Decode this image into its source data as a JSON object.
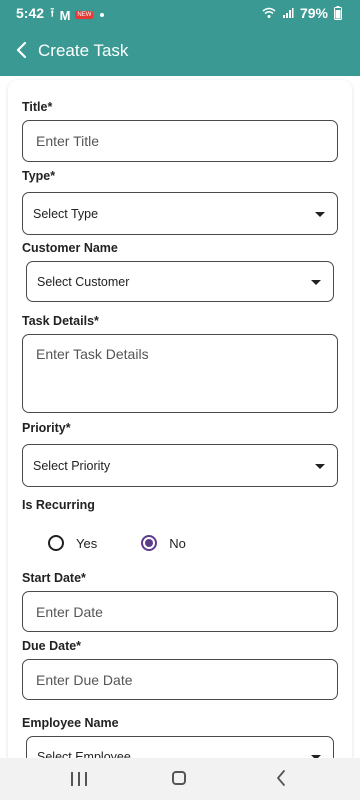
{
  "status": {
    "time": "5:42",
    "battery": "79%",
    "badge": "NEW"
  },
  "appbar": {
    "title": "Create Task"
  },
  "form": {
    "title_label": "Title*",
    "title_placeholder": "Enter Title",
    "type_label": "Type*",
    "type_value": "Select Type",
    "customer_label": "Customer Name",
    "customer_value": "Select Customer",
    "details_label": "Task Details*",
    "details_placeholder": "Enter Task Details",
    "priority_label": "Priority*",
    "priority_value": "Select Priority",
    "recurring_label": "Is Recurring",
    "recurring_yes": "Yes",
    "recurring_no": "No",
    "recurring_selected": "No",
    "start_label": "Start Date*",
    "start_placeholder": "Enter Date",
    "due_label": "Due Date*",
    "due_placeholder": "Enter Due Date",
    "employee_label": "Employee Name",
    "employee_value": "Select Employee"
  },
  "colors": {
    "primary": "#3a9a93",
    "radio_selected": "#5e3b8a"
  }
}
